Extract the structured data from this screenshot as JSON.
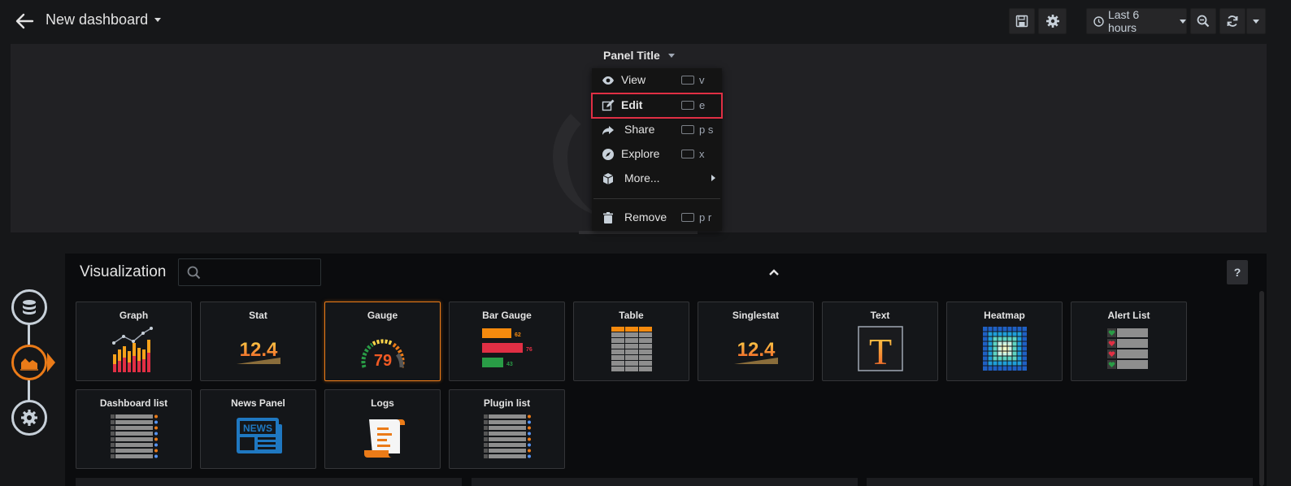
{
  "header": {
    "title": "New dashboard",
    "time_range": "Last 6 hours"
  },
  "panel": {
    "title": "Panel Title"
  },
  "context_menu": {
    "items": [
      {
        "label": "View",
        "shortcut": "v",
        "icon": "eye-icon"
      },
      {
        "label": "Edit",
        "shortcut": "e",
        "icon": "edit-icon",
        "highlighted": true
      },
      {
        "label": "Share",
        "shortcut": "p s",
        "icon": "share-icon"
      },
      {
        "label": "Explore",
        "shortcut": "x",
        "icon": "compass-icon"
      },
      {
        "label": "More...",
        "shortcut": "",
        "icon": "cube-icon",
        "submenu": true
      },
      {
        "label": "Remove",
        "shortcut": "p r",
        "icon": "trash-icon"
      }
    ]
  },
  "editor": {
    "title": "Visualization",
    "search_placeholder": "",
    "help_label": "?",
    "visualizations": [
      {
        "name": "Graph"
      },
      {
        "name": "Stat",
        "value": "12.4"
      },
      {
        "name": "Gauge",
        "value": "79",
        "selected": true
      },
      {
        "name": "Bar Gauge",
        "values": [
          "62",
          "76",
          "43"
        ]
      },
      {
        "name": "Table"
      },
      {
        "name": "Singlestat",
        "value": "12.4"
      },
      {
        "name": "Text",
        "glyph": "T"
      },
      {
        "name": "Heatmap"
      },
      {
        "name": "Alert List"
      },
      {
        "name": "Dashboard list"
      },
      {
        "name": "News Panel",
        "badge": "NEWS"
      },
      {
        "name": "Logs"
      },
      {
        "name": "Plugin list"
      }
    ]
  },
  "colors": {
    "accent": "#eb7b18",
    "highlight_border": "#e02f44",
    "panel_bg": "#212124",
    "page_bg": "#161719"
  }
}
